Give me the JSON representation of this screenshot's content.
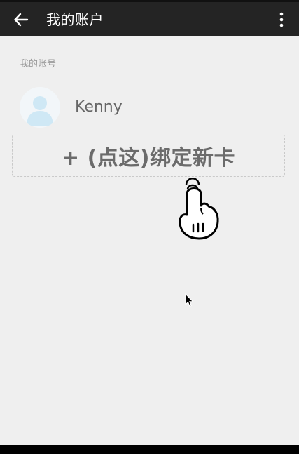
{
  "topbar": {
    "title": "我的账户",
    "back_icon": "arrow-left-icon",
    "more_icon": "more-vertical-icon"
  },
  "account": {
    "section_label": "我的账号",
    "username": "Kenny",
    "avatar_icon": "user-avatar-icon"
  },
  "bind_card": {
    "label": "+ (点这)绑定新卡"
  },
  "overlays": {
    "hand_icon": "pointing-hand-icon",
    "cursor_icon": "mouse-cursor-icon"
  },
  "colors": {
    "topbar_bg": "#242424",
    "page_bg": "#efefef",
    "avatar_accent": "#cfe8f5"
  }
}
